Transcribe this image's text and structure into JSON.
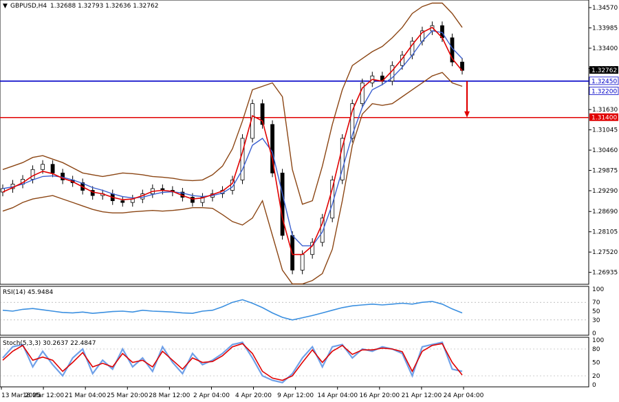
{
  "header": {
    "symbol": "GBPUSD,H4",
    "ohlc": "1.32688 1.32793 1.32636 1.32762"
  },
  "colors": {
    "candle": "#000000",
    "bollinger": "#8B4513",
    "ma_fast": "#e00000",
    "ma_slow": "#3a5fd0",
    "support_line": "#0000c8",
    "target_line": "#e00000",
    "rsi": "#3a8fe0",
    "stoch_main": "#6fa0e8",
    "stoch_signal": "#e00000",
    "arrow": "#e00000",
    "current_price_box": "#000000"
  },
  "chart_data": [
    {
      "type": "line",
      "panel": "price",
      "title": "GBPUSD,H4",
      "ylim": [
        1.2665,
        1.3475
      ],
      "y_ticks": [
        "1.34570",
        "1.33985",
        "1.33400",
        "1.32815",
        "1.32215",
        "1.31630",
        "1.31045",
        "1.30460",
        "1.29875",
        "1.29290",
        "1.28690",
        "1.28105",
        "1.27520",
        "1.26935"
      ],
      "price_labels": [
        {
          "value": 1.32762,
          "text": "1.32762",
          "style": "current"
        },
        {
          "value": 1.3245,
          "text": "1.32450",
          "style": "support"
        },
        {
          "value": 1.322,
          "text": "1.32200",
          "style": "support"
        },
        {
          "value": 1.314,
          "text": "1.31400",
          "style": "target"
        }
      ],
      "horizontal_lines": [
        {
          "name": "support",
          "value": 1.3245
        },
        {
          "name": "target",
          "value": 1.314
        }
      ],
      "x_labels": [
        "13 Mar 2025",
        "18 Mar 12:00",
        "21 Mar 04:00",
        "25 Mar 20:00",
        "28 Mar 12:00",
        "2 Apr 04:00",
        "4 Apr 20:00",
        "9 Apr 12:00",
        "14 Apr 04:00",
        "16 Apr 20:00",
        "21 Apr 12:00",
        "24 Apr 04:00"
      ],
      "close": [
        1.2935,
        1.2948,
        1.2962,
        1.299,
        1.3005,
        1.298,
        1.296,
        1.2952,
        1.293,
        1.2915,
        1.292,
        1.29,
        1.2895,
        1.2905,
        1.292,
        1.2935,
        1.293,
        1.2925,
        1.291,
        1.2895,
        1.291,
        1.292,
        1.293,
        1.296,
        1.308,
        1.318,
        1.312,
        1.298,
        1.28,
        1.27,
        1.2745,
        1.278,
        1.285,
        1.296,
        1.308,
        1.318,
        1.324,
        1.326,
        1.3245,
        1.329,
        1.332,
        1.336,
        1.339,
        1.3405,
        1.337,
        1.33,
        1.3276
      ],
      "ma_fast": [
        1.2925,
        1.2938,
        1.2952,
        1.2972,
        1.2985,
        1.2978,
        1.2965,
        1.2955,
        1.294,
        1.2925,
        1.292,
        1.291,
        1.2903,
        1.2905,
        1.2915,
        1.2927,
        1.293,
        1.2927,
        1.2915,
        1.2905,
        1.2908,
        1.2918,
        1.2928,
        1.295,
        1.304,
        1.3145,
        1.313,
        1.302,
        1.285,
        1.2745,
        1.2745,
        1.277,
        1.2835,
        1.2935,
        1.3055,
        1.316,
        1.3225,
        1.325,
        1.3245,
        1.3275,
        1.331,
        1.335,
        1.3385,
        1.34,
        1.337,
        1.331,
        1.3275
      ],
      "ma_slow": [
        1.2935,
        1.294,
        1.2948,
        1.296,
        1.297,
        1.2972,
        1.2968,
        1.296,
        1.295,
        1.2938,
        1.293,
        1.292,
        1.2912,
        1.2908,
        1.291,
        1.2918,
        1.2924,
        1.2926,
        1.2922,
        1.2915,
        1.2912,
        1.2915,
        1.2922,
        1.294,
        1.299,
        1.306,
        1.308,
        1.304,
        1.292,
        1.28,
        1.277,
        1.277,
        1.281,
        1.289,
        1.299,
        1.309,
        1.317,
        1.322,
        1.3235,
        1.3255,
        1.3285,
        1.332,
        1.336,
        1.339,
        1.3385,
        1.334,
        1.331
      ],
      "bb_upper": [
        1.299,
        1.3,
        1.301,
        1.3025,
        1.303,
        1.302,
        1.301,
        1.2995,
        1.298,
        1.2975,
        1.297,
        1.2975,
        1.298,
        1.2978,
        1.2975,
        1.297,
        1.2968,
        1.2965,
        1.296,
        1.2958,
        1.296,
        1.2975,
        1.3,
        1.305,
        1.313,
        1.322,
        1.323,
        1.324,
        1.32,
        1.299,
        1.289,
        1.29,
        1.3,
        1.312,
        1.322,
        1.329,
        1.331,
        1.333,
        1.3345,
        1.337,
        1.34,
        1.344,
        1.346,
        1.347,
        1.347,
        1.344,
        1.34
      ],
      "bb_lower": [
        1.287,
        1.288,
        1.2895,
        1.2905,
        1.291,
        1.2915,
        1.2905,
        1.2895,
        1.2885,
        1.2875,
        1.2868,
        1.2865,
        1.2865,
        1.2868,
        1.287,
        1.2872,
        1.287,
        1.2872,
        1.2875,
        1.288,
        1.288,
        1.2878,
        1.286,
        1.284,
        1.283,
        1.285,
        1.29,
        1.28,
        1.27,
        1.266,
        1.266,
        1.267,
        1.269,
        1.276,
        1.29,
        1.306,
        1.315,
        1.318,
        1.3175,
        1.318,
        1.32,
        1.322,
        1.324,
        1.326,
        1.327,
        1.324,
        1.323
      ]
    },
    {
      "type": "line",
      "panel": "rsi",
      "title": "RSI(14) 45.9484",
      "ylim": [
        0,
        100
      ],
      "y_ticks": [
        100,
        70,
        50,
        30,
        0
      ],
      "series": [
        {
          "name": "RSI(14)",
          "values": [
            52,
            50,
            54,
            56,
            53,
            50,
            47,
            46,
            48,
            45,
            47,
            49,
            50,
            48,
            52,
            50,
            49,
            48,
            46,
            45,
            50,
            52,
            60,
            70,
            76,
            68,
            58,
            46,
            36,
            30,
            35,
            40,
            46,
            52,
            58,
            62,
            64,
            66,
            64,
            66,
            68,
            66,
            70,
            72,
            66,
            55,
            46
          ]
        }
      ]
    },
    {
      "type": "line",
      "panel": "stoch",
      "title": "Stoch(5,3,3) 30.2637 22.4847",
      "ylim": [
        0,
        100
      ],
      "y_ticks": [
        100,
        80,
        50,
        20,
        0
      ],
      "series": [
        {
          "name": "main",
          "values": [
            60,
            85,
            90,
            40,
            75,
            45,
            20,
            60,
            80,
            25,
            55,
            35,
            80,
            40,
            60,
            30,
            85,
            50,
            25,
            70,
            45,
            55,
            70,
            90,
            95,
            60,
            20,
            10,
            5,
            25,
            60,
            85,
            40,
            85,
            90,
            60,
            80,
            75,
            85,
            80,
            70,
            20,
            85,
            90,
            95,
            35,
            30
          ]
        },
        {
          "name": "signal",
          "values": [
            55,
            75,
            88,
            55,
            62,
            55,
            30,
            50,
            72,
            40,
            48,
            40,
            70,
            50,
            55,
            40,
            75,
            55,
            35,
            60,
            50,
            52,
            65,
            85,
            92,
            70,
            30,
            15,
            10,
            20,
            50,
            78,
            50,
            75,
            88,
            68,
            78,
            78,
            82,
            80,
            74,
            30,
            75,
            88,
            92,
            50,
            22
          ]
        }
      ]
    }
  ]
}
